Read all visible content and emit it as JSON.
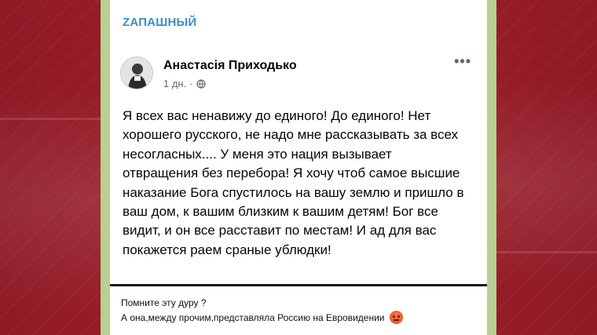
{
  "channel": {
    "name": "ZАПАШНЫЙ"
  },
  "post": {
    "author": "Анастасія Приходько",
    "time": "1 дн.",
    "more_icon": "more-horizontal-icon",
    "globe_icon": "globe-icon",
    "text": "Я всех вас ненавижу до единого! До единого! Нет хорошего русского, не надо мне рассказывать за всех несогласных.... У меня это нация вызывает отвращения без перебора! Я хочу чтоб самое высшие наказание Бога спустилось на вашу землю и пришло в ваш дом, к вашим близким к вашим детям! Бог все видит, и он все расставит по местам! И ад для вас покажется раем сраные ублюдки!"
  },
  "caption": {
    "line1": "Помните эту дуру ?",
    "line2": "А она,между прочим,представляла Россию на Евровидении",
    "emoji": "angry-face-emoji"
  },
  "colors": {
    "channel_name": "#3a8ec9",
    "background_red": "#a4202d",
    "chat_green": "#b9cf93"
  }
}
